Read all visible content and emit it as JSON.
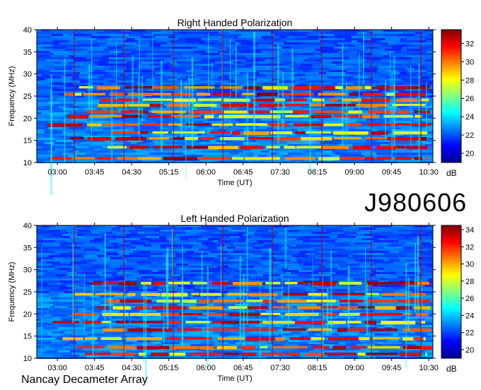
{
  "observation_id": "J980606",
  "footer": "Nancay Decameter Array",
  "chart_data": [
    {
      "type": "heatmap",
      "title": "Right Handed Polarization",
      "xlabel": "Time (UT)",
      "ylabel": "Frequency (MHz)",
      "x_ticks": [
        "03:00",
        "03:45",
        "04:30",
        "05:15",
        "06:00",
        "06:45",
        "07:30",
        "08:15",
        "09:00",
        "09:45",
        "10:30"
      ],
      "x_range": [
        "02:35",
        "10:35"
      ],
      "ylim": [
        10,
        40
      ],
      "y_ticks": [
        10,
        15,
        20,
        25,
        30,
        35,
        40
      ],
      "colorbar": {
        "label": "dB",
        "ticks": [
          20,
          22,
          24,
          26,
          28,
          30,
          32
        ],
        "range": [
          19,
          33.5
        ],
        "colormap": "jet"
      },
      "emission_bands_mhz": [
        11,
        13.5,
        15.5,
        16.8,
        18.6,
        20.5,
        21.5,
        23,
        24.2,
        25.5,
        27
      ]
    },
    {
      "type": "heatmap",
      "title": "Left Handed Polarization",
      "xlabel": "Time (UT)",
      "ylabel": "Frequency (MHz)",
      "x_ticks": [
        "03:00",
        "03:45",
        "04:30",
        "05:15",
        "06:00",
        "06:45",
        "07:30",
        "08:15",
        "09:00",
        "09:45",
        "10:30"
      ],
      "x_range": [
        "02:35",
        "10:35"
      ],
      "ylim": [
        10,
        40
      ],
      "y_ticks": [
        10,
        15,
        20,
        25,
        30,
        35,
        40
      ],
      "colorbar": {
        "label": "dB",
        "ticks": [
          20,
          22,
          24,
          26,
          28,
          30,
          32,
          34
        ],
        "range": [
          19,
          34.5
        ],
        "colormap": "jet"
      },
      "emission_bands_mhz": [
        11,
        12.5,
        14.5,
        16.5,
        18.2,
        20,
        21.5,
        23,
        24.5,
        27
      ]
    }
  ]
}
